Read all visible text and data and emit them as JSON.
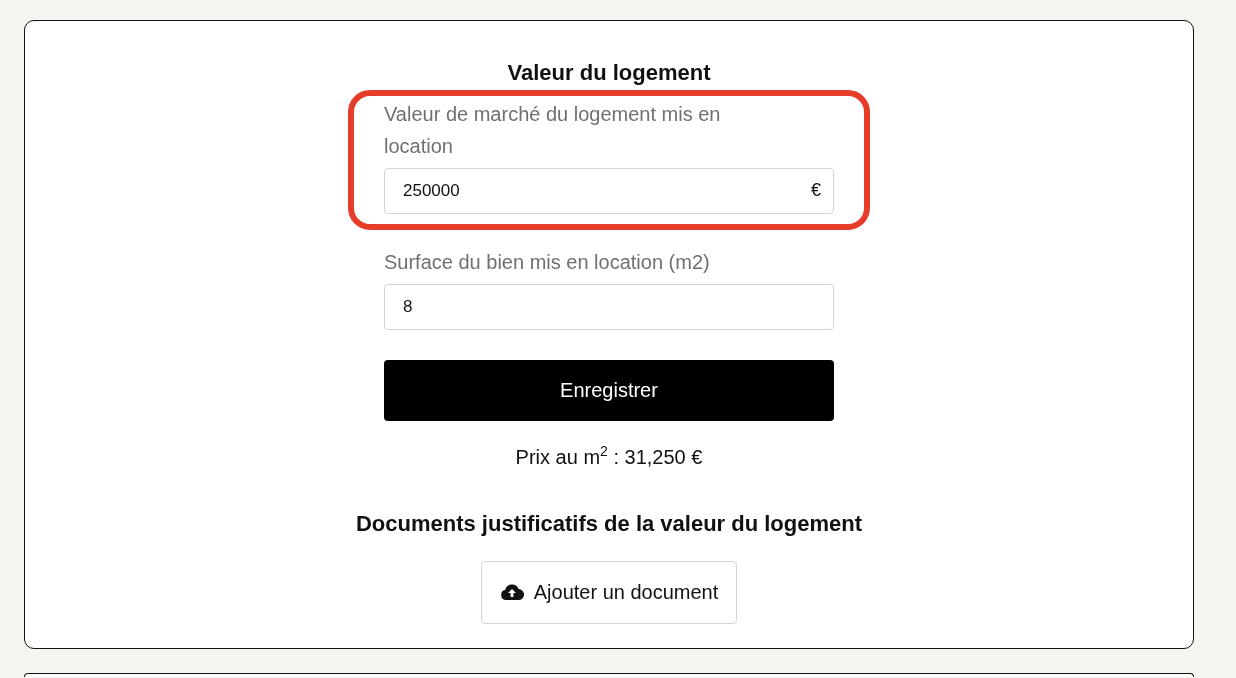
{
  "section_title": "Valeur du logement",
  "fields": [
    {
      "label": "Valeur de marché du logement mis en location",
      "value": "250000",
      "suffix": "€",
      "highlighted": true
    },
    {
      "label": "Surface du bien mis en location (m2)",
      "value": "8",
      "highlighted": false
    }
  ],
  "save_button": "Enregistrer",
  "price_per_m2": "Prix au m$^{2}$ : 31,250 €",
  "documents_title": "Documents justificatifs de la valeur du logement",
  "add_document_button": "Ajouter un document"
}
